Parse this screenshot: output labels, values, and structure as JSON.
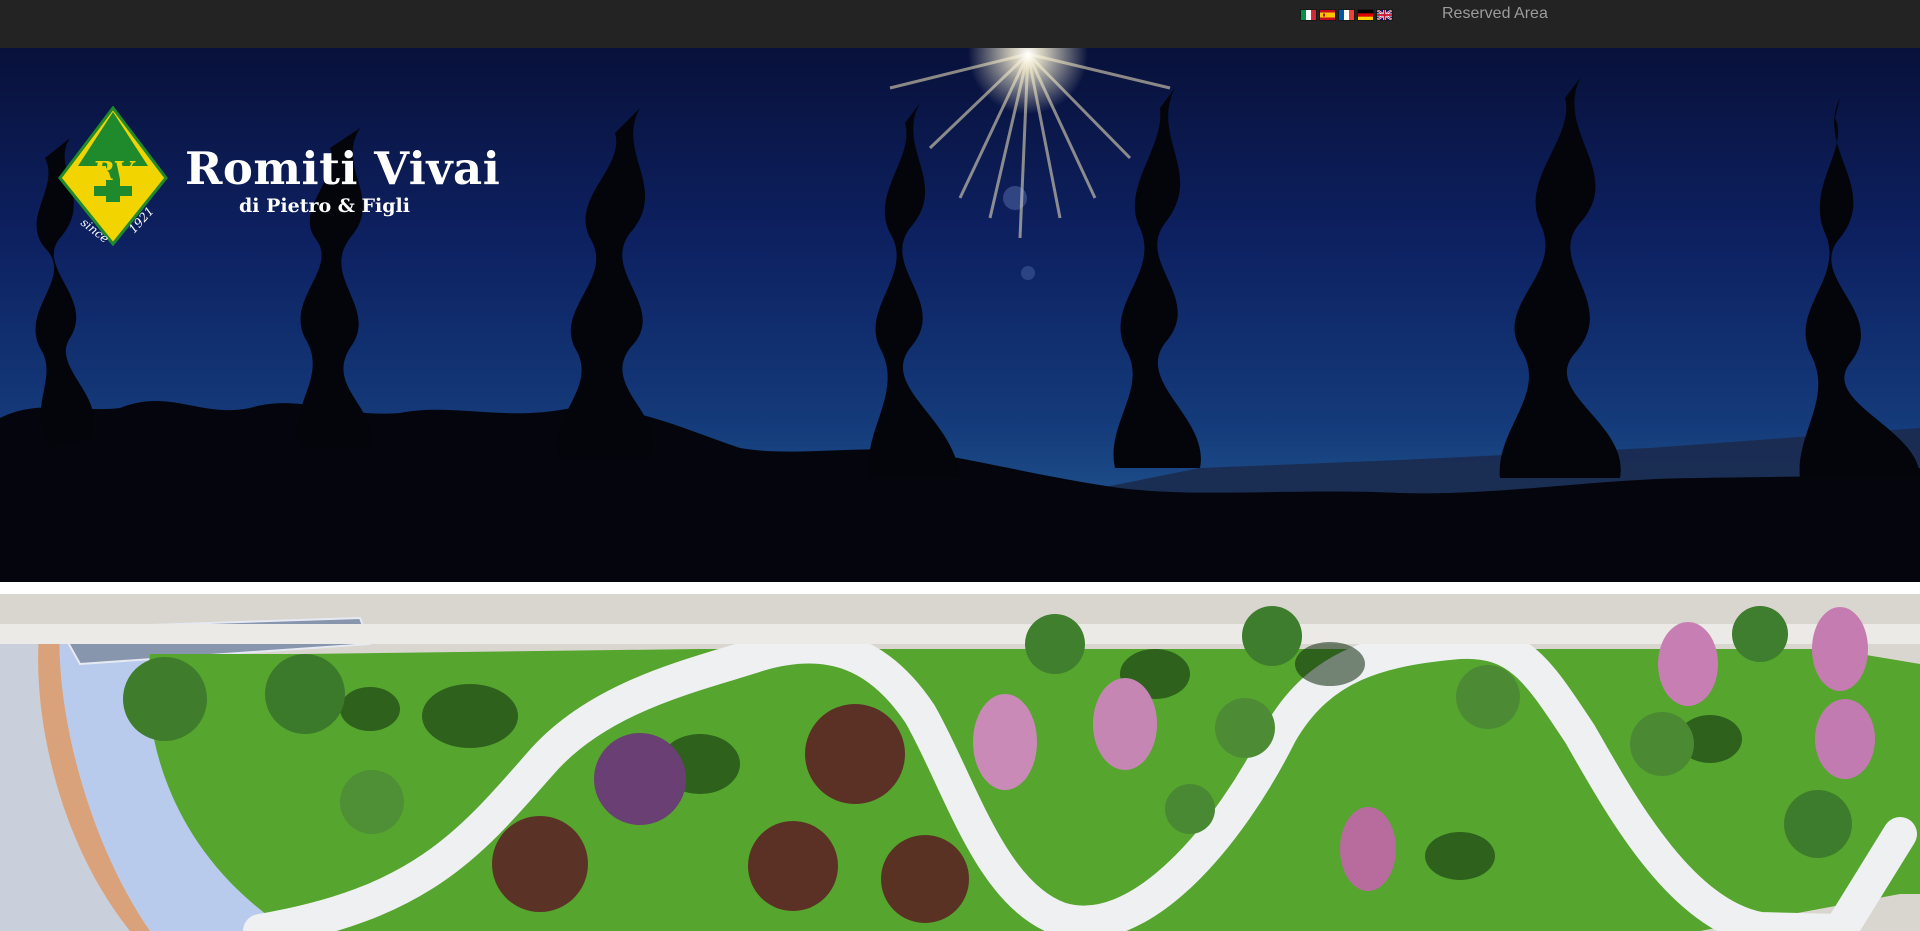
{
  "topbar": {
    "languages": [
      {
        "code": "it",
        "icon": "italy-flag-icon"
      },
      {
        "code": "es",
        "icon": "spain-flag-icon"
      },
      {
        "code": "fr",
        "icon": "france-flag-icon"
      },
      {
        "code": "de",
        "icon": "germany-flag-icon"
      },
      {
        "code": "en",
        "icon": "uk-flag-icon"
      }
    ],
    "reserved_area_label": "Reserved Area"
  },
  "brand": {
    "title": "Romiti Vivai",
    "subtitle": "di Pietro & Figli",
    "logo_monogram": "RV",
    "logo_since": "since",
    "logo_year": "1921"
  },
  "colors": {
    "topbar_bg": "#232323",
    "logo_green": "#1f8a2c",
    "logo_yellow": "#f1d400",
    "sky_dark": "#0b1a4a"
  }
}
